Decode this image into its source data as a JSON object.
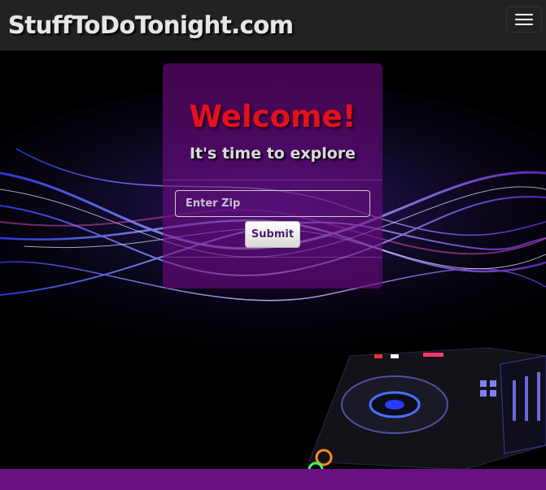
{
  "navbar": {
    "brand": "StuffToDoTonight.com",
    "menu_icon": "hamburger-menu-icon"
  },
  "hero": {
    "image": "dj-turntable-light-streaks",
    "colors": {
      "panel": "#6e0a82",
      "welcome": "#e4101c",
      "footer": "#6a1080"
    }
  },
  "panel": {
    "welcome": "Welcome!",
    "tagline": "It's time to explore",
    "zip_placeholder": "Enter Zip",
    "zip_value": "",
    "submit_label": "Submit"
  }
}
